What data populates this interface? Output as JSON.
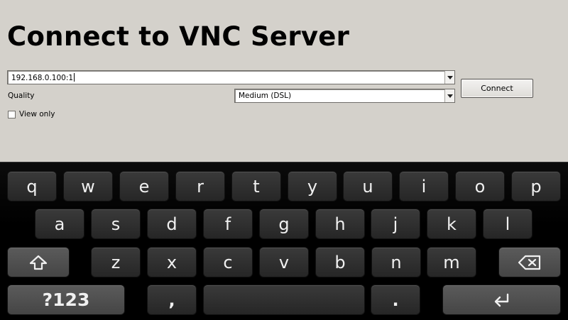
{
  "dialog": {
    "title": "Connect to VNC Server",
    "host_value": "192.168.0.100:1",
    "quality_label": "Quality",
    "quality_value": "Medium (DSL)",
    "view_only_label": "View only",
    "view_only_checked": false,
    "connect_label": "Connect"
  },
  "keyboard": {
    "row1": [
      "q",
      "w",
      "e",
      "r",
      "t",
      "y",
      "u",
      "i",
      "o",
      "p"
    ],
    "row2": [
      "a",
      "s",
      "d",
      "f",
      "g",
      "h",
      "j",
      "k",
      "l"
    ],
    "row3": [
      "z",
      "x",
      "c",
      "v",
      "b",
      "n",
      "m"
    ],
    "shift_icon": "shift-icon",
    "backspace_icon": "backspace-icon",
    "symbols_label": "?123",
    "comma_label": ",",
    "period_label": ".",
    "enter_icon": "enter-icon",
    "space_icon": "space-bar"
  }
}
